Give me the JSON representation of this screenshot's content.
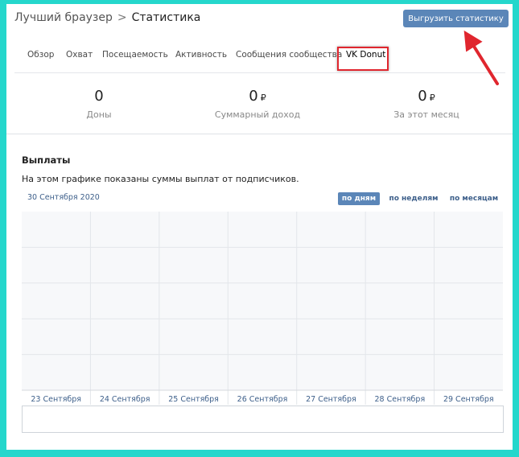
{
  "header": {
    "breadcrumb_parent": "Лучший браузер",
    "breadcrumb_separator": ">",
    "page_title": "Статистика",
    "export_button": "Выгрузить статистику"
  },
  "tabs": [
    {
      "label": "Обзор"
    },
    {
      "label": "Охват"
    },
    {
      "label": "Посещаемость"
    },
    {
      "label": "Активность"
    },
    {
      "label": "Сообщения сообщества"
    },
    {
      "label": "VK Donut",
      "active": true
    }
  ],
  "stats": [
    {
      "value": "0",
      "currency": "",
      "label": "Доны"
    },
    {
      "value": "0",
      "currency": "₽",
      "label": "Суммарный доход"
    },
    {
      "value": "0",
      "currency": "₽",
      "label": "За этот месяц"
    }
  ],
  "payouts": {
    "title": "Выплаты",
    "description": "На этом графике показаны суммы выплат от подписчиков.",
    "date": "30 Сентября 2020",
    "periods": [
      {
        "label": "по дням",
        "active": true
      },
      {
        "label": "по неделям",
        "active": false
      },
      {
        "label": "по месяцам",
        "active": false
      }
    ]
  },
  "chart_data": {
    "type": "line",
    "categories": [
      "23 Сентября",
      "24 Сентября",
      "25 Сентября",
      "26 Сентября",
      "27 Сентября",
      "28 Сентября",
      "29 Сентября"
    ],
    "series": [],
    "grid": true
  },
  "colors": {
    "background": "#25d7cc",
    "accent": "#5b86b8",
    "highlight": "#e0262e",
    "link": "#3d5f8a"
  }
}
